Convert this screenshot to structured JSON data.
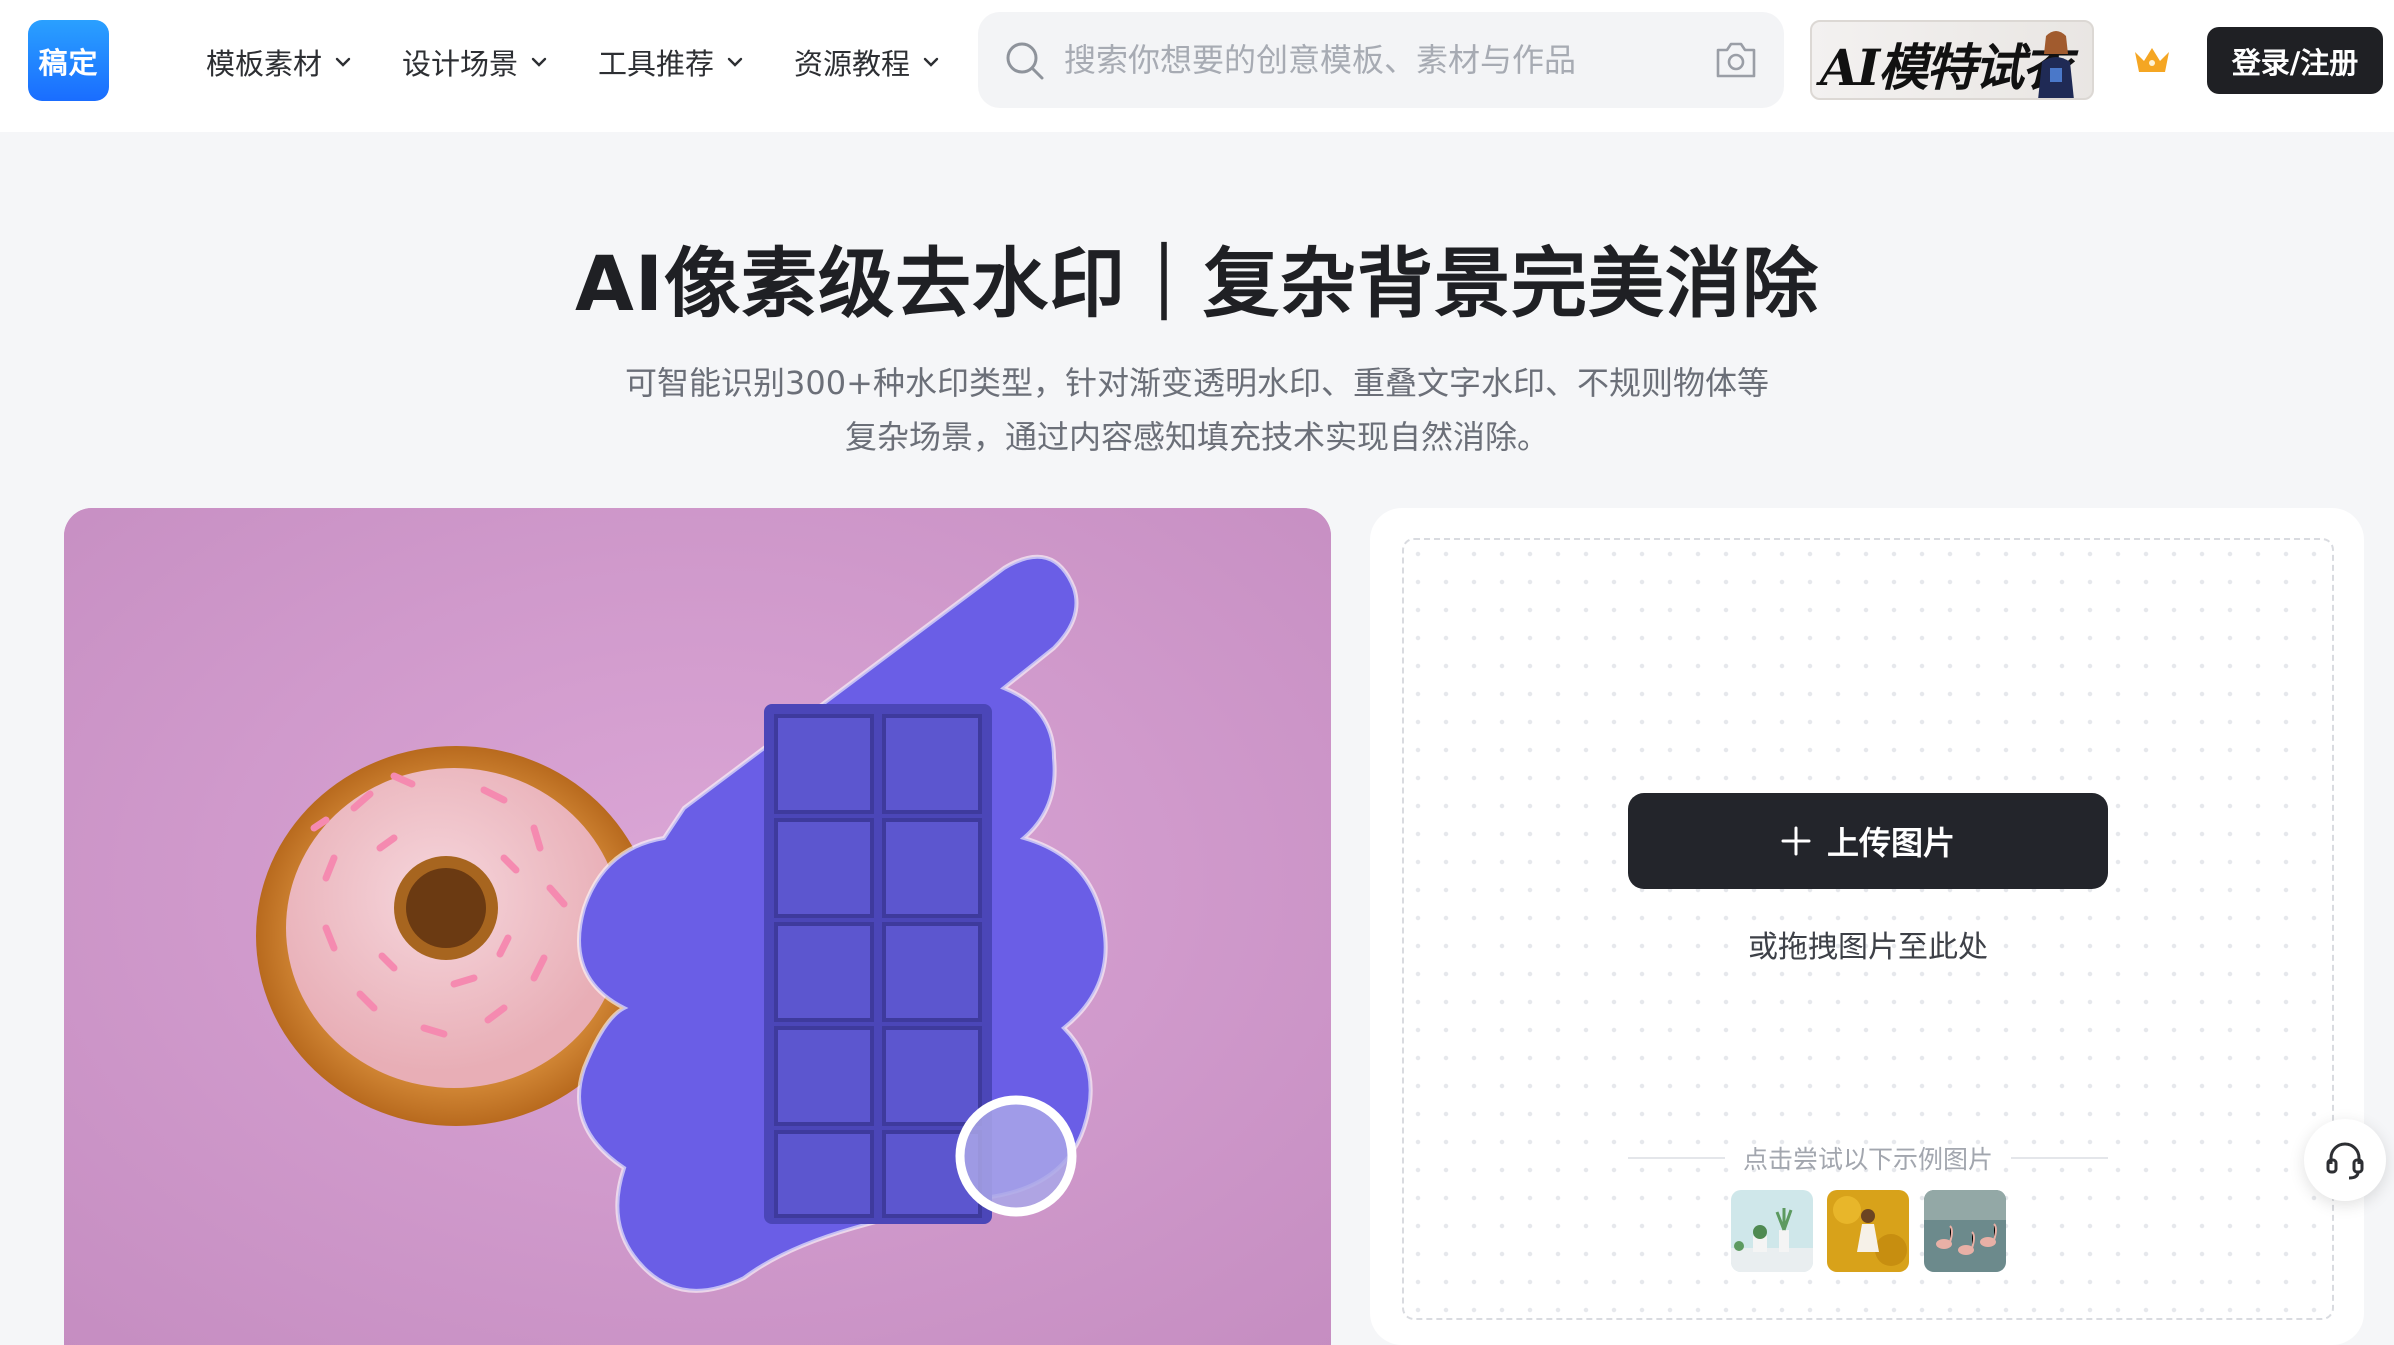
{
  "header": {
    "logo_text": "稿定",
    "nav": [
      {
        "label": "模板素材"
      },
      {
        "label": "设计场景"
      },
      {
        "label": "工具推荐"
      },
      {
        "label": "资源教程"
      }
    ],
    "search": {
      "placeholder": "搜索你想要的创意模板、素材与作品"
    },
    "ai_banner_text": "AI模特试衣",
    "login_label": "登录/注册"
  },
  "hero": {
    "title": "AI像素级去水印｜复杂背景完美消除",
    "description_line1": "可智能识别300+种水印类型，针对渐变透明水印、重叠文字水印、不规则物体等",
    "description_line2": "复杂场景，通过内容感知填充技术实现自然消除。"
  },
  "upload": {
    "button_label": "上传图片",
    "drag_hint": "或拖拽图片至此处",
    "sample_hint": "点击尝试以下示例图片"
  },
  "colors": {
    "accent_dark": "#1f2024",
    "demo_background": "#cf97cc",
    "mask_purple": "#6a5ee6",
    "crown_gold": "#f5a623"
  },
  "icons": {
    "search": "search-icon",
    "camera": "camera-icon",
    "crown": "crown-icon",
    "plus": "plus-icon",
    "support": "headset-icon"
  }
}
